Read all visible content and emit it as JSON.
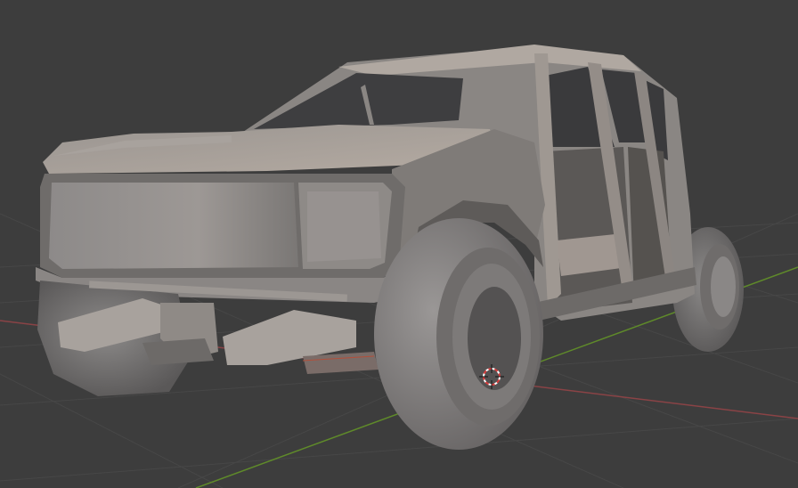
{
  "viewport": {
    "background": "#3d3d3d",
    "grid_color": "#4a4a4a",
    "x_axis_color": "#a04a4e",
    "y_axis_color": "#6d9a2e"
  },
  "model": {
    "body_color": "#8f8c8a",
    "highlight_color": "#b3aca6",
    "shadow_color": "#4a4847",
    "interior_color": "#3e3e40"
  },
  "gizmo": {
    "icon": "3d-cursor-icon",
    "ring_colors": [
      "#d83c3c",
      "#ffffff"
    ]
  }
}
